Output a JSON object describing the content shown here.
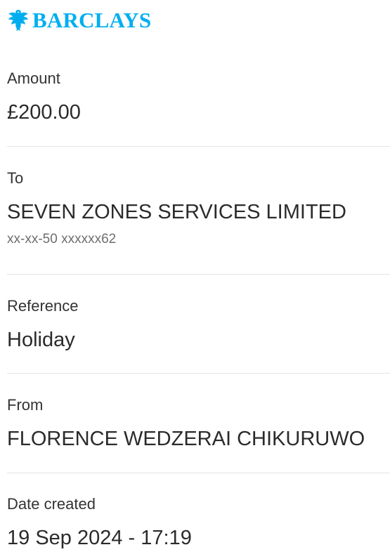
{
  "brand": {
    "name": "BARCLAYS",
    "color": "#00aeef",
    "icon": "eagle-icon"
  },
  "amount": {
    "label": "Amount",
    "value": "£200.00"
  },
  "to": {
    "label": "To",
    "name": "SEVEN ZONES SERVICES LIMITED",
    "account": "xx-xx-50 xxxxxx62"
  },
  "reference": {
    "label": "Reference",
    "value": "Holiday"
  },
  "from": {
    "label": "From",
    "value": "FLORENCE WEDZERAI CHIKURUWO"
  },
  "date_created": {
    "label": "Date created",
    "value": "19 Sep 2024 - 17:19"
  }
}
